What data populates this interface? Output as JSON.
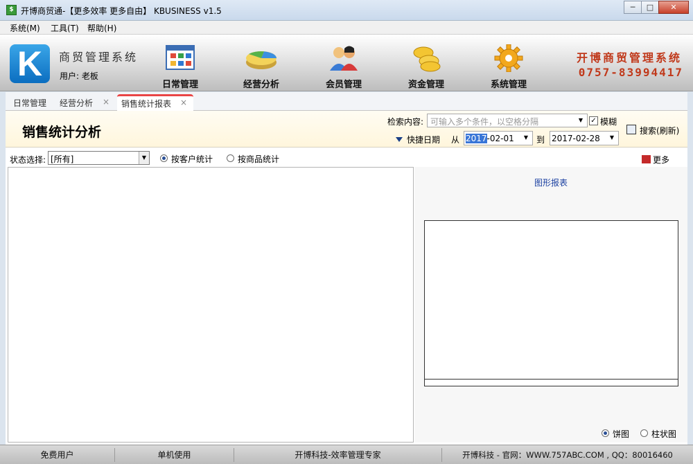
{
  "window": {
    "title": "开博商贸通-【更多效率 更多自由】 KBUSINESS v1.5",
    "icon_label": "$"
  },
  "menu": [
    "系统(M)",
    "工具(T)",
    "帮助(H)"
  ],
  "banner": {
    "logo_letter": "K",
    "system_name": "商贸管理系统",
    "user_line": "用户: 老板",
    "tools": [
      {
        "label": "日常管理",
        "icon": "calendar-grid-icon"
      },
      {
        "label": "经营分析",
        "icon": "pie-chart-icon"
      },
      {
        "label": "会员管理",
        "icon": "members-icon"
      },
      {
        "label": "资金管理",
        "icon": "coins-icon"
      },
      {
        "label": "系统管理",
        "icon": "gear-icon"
      }
    ],
    "brand_name": "开博商贸管理系统",
    "brand_phone": "0757-83994417"
  },
  "tabs": [
    {
      "label": "日常管理"
    },
    {
      "label": "经营分析"
    },
    {
      "label": "销售统计报表"
    }
  ],
  "tab_close_glyph": "×",
  "page": {
    "title": "销售统计分析",
    "search_label": "检索内容:",
    "search_placeholder": "可输入多个条件，以空格分隔",
    "fuzzy_label": "模糊",
    "search_button": "搜索(刷新)",
    "quick_date_label": "快捷日期",
    "from_label": "从",
    "from_date_selected": "2017",
    "from_date_rest": "-02-01",
    "to_label": "到",
    "to_date": "2017-02-28"
  },
  "filter": {
    "status_label": "状态选择:",
    "status_value": "[所有]",
    "radio_customer": "按客户统计",
    "radio_product": "按商品统计",
    "more_label": "更多"
  },
  "chart": {
    "title": "图形报表",
    "radio_pie": "饼图",
    "radio_bar": "柱状图"
  },
  "statusbar": [
    "免费用户",
    "单机使用",
    "开博科技-效率管理专家",
    "开博科技 - 官网：WWW.757ABC.COM , QQ：80016460"
  ],
  "colors": {
    "accent_red": "#c0391b",
    "tab_active_border": "#e94545",
    "link_blue": "#1a3fa0"
  }
}
